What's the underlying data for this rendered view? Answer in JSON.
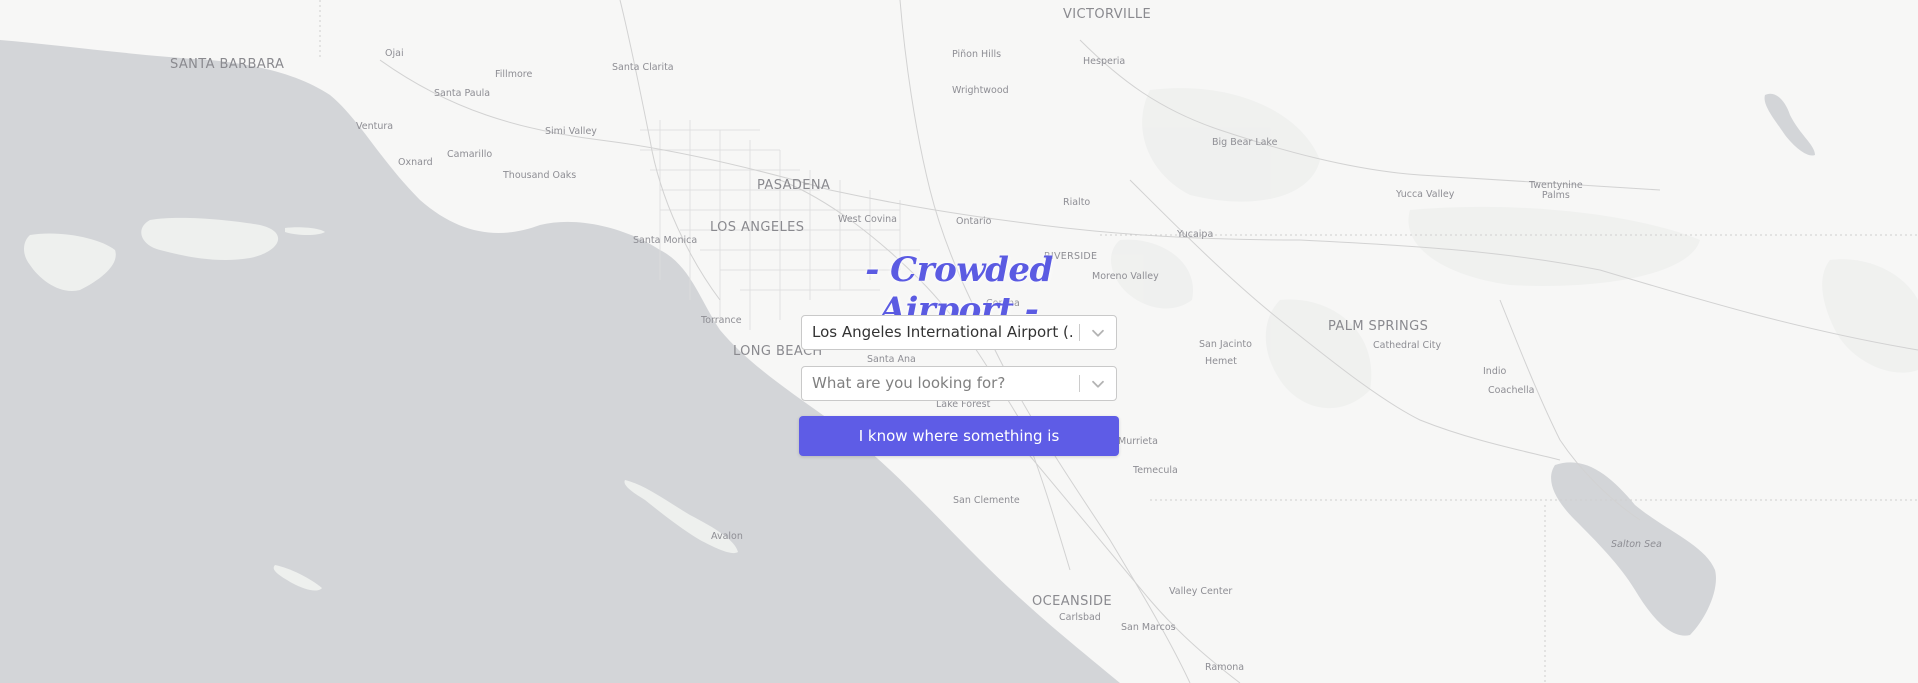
{
  "app": {
    "title": "- Crowded Airport -",
    "accent_color": "#5e5ce6"
  },
  "airport_select": {
    "value": "Los Angeles International Airport (...",
    "icon": "chevron-down-icon"
  },
  "search_select": {
    "placeholder": "What are you looking for?",
    "icon": "chevron-down-icon"
  },
  "report_button": {
    "label": "I know where something is"
  },
  "map": {
    "water_color": "#d4d6d9",
    "land_color": "#f7f7f6",
    "labels": [
      {
        "id": "victorville",
        "text": "VICTORVILLE",
        "kind": "city"
      },
      {
        "id": "santa-barbara",
        "text": "SANTA BARBARA",
        "kind": "city"
      },
      {
        "id": "ojai",
        "text": "Ojai",
        "kind": "small"
      },
      {
        "id": "santa-clarita",
        "text": "Santa Clarita",
        "kind": "small"
      },
      {
        "id": "pinon-hills",
        "text": "Piñon Hills",
        "kind": "small"
      },
      {
        "id": "hesperia",
        "text": "Hesperia",
        "kind": "small"
      },
      {
        "id": "fillmore",
        "text": "Fillmore",
        "kind": "small"
      },
      {
        "id": "santa-paula",
        "text": "Santa Paula",
        "kind": "small"
      },
      {
        "id": "wrightwood",
        "text": "Wrightwood",
        "kind": "small"
      },
      {
        "id": "ventura",
        "text": "Ventura",
        "kind": "small"
      },
      {
        "id": "simi-valley",
        "text": "Simi Valley",
        "kind": "small"
      },
      {
        "id": "big-bear-lake",
        "text": "Big Bear Lake",
        "kind": "small"
      },
      {
        "id": "camarillo",
        "text": "Camarillo",
        "kind": "small"
      },
      {
        "id": "oxnard",
        "text": "Oxnard",
        "kind": "small"
      },
      {
        "id": "thousand-oaks",
        "text": "Thousand Oaks",
        "kind": "small"
      },
      {
        "id": "pasadena",
        "text": "PASADENA",
        "kind": "city"
      },
      {
        "id": "twentynine-palms",
        "text": "Twentynine\nPalms",
        "kind": "small"
      },
      {
        "id": "yucca-valley",
        "text": "Yucca Valley",
        "kind": "small"
      },
      {
        "id": "rialto",
        "text": "Rialto",
        "kind": "small"
      },
      {
        "id": "west-covina",
        "text": "West Covina",
        "kind": "small"
      },
      {
        "id": "ontario",
        "text": "Ontario",
        "kind": "small"
      },
      {
        "id": "los-angeles",
        "text": "LOS ANGELES",
        "kind": "city"
      },
      {
        "id": "yucaipa",
        "text": "Yucaipa",
        "kind": "small"
      },
      {
        "id": "santa-monica",
        "text": "Santa Monica",
        "kind": "small"
      },
      {
        "id": "riverside",
        "text": "RIVERSIDE",
        "kind": "city"
      },
      {
        "id": "moreno-valley",
        "text": "Moreno Valley",
        "kind": "small"
      },
      {
        "id": "corona",
        "text": "Corona",
        "kind": "small"
      },
      {
        "id": "torrance",
        "text": "Torrance",
        "kind": "small"
      },
      {
        "id": "palm-springs",
        "text": "PALM SPRINGS",
        "kind": "city"
      },
      {
        "id": "san-jacinto",
        "text": "San Jacinto",
        "kind": "small"
      },
      {
        "id": "cathedral-city",
        "text": "Cathedral City",
        "kind": "small"
      },
      {
        "id": "long-beach",
        "text": "LONG BEACH",
        "kind": "city"
      },
      {
        "id": "hemet",
        "text": "Hemet",
        "kind": "small"
      },
      {
        "id": "santa-ana",
        "text": "Santa Ana",
        "kind": "small"
      },
      {
        "id": "indio",
        "text": "Indio",
        "kind": "small"
      },
      {
        "id": "coachella",
        "text": "Coachella",
        "kind": "small"
      },
      {
        "id": "lake-forest",
        "text": "Lake Forest",
        "kind": "small"
      },
      {
        "id": "murrieta",
        "text": "Murrieta",
        "kind": "small"
      },
      {
        "id": "temecula",
        "text": "Temecula",
        "kind": "small"
      },
      {
        "id": "san-clemente",
        "text": "San Clemente",
        "kind": "small"
      },
      {
        "id": "avalon",
        "text": "Avalon",
        "kind": "small"
      },
      {
        "id": "salton-sea",
        "text": "Salton Sea",
        "kind": "small"
      },
      {
        "id": "valley-center",
        "text": "Valley Center",
        "kind": "small"
      },
      {
        "id": "oceanside",
        "text": "OCEANSIDE",
        "kind": "city"
      },
      {
        "id": "carlsbad",
        "text": "Carlsbad",
        "kind": "small"
      },
      {
        "id": "san-marcos",
        "text": "San Marcos",
        "kind": "small"
      },
      {
        "id": "ramona",
        "text": "Ramona",
        "kind": "small"
      }
    ]
  }
}
